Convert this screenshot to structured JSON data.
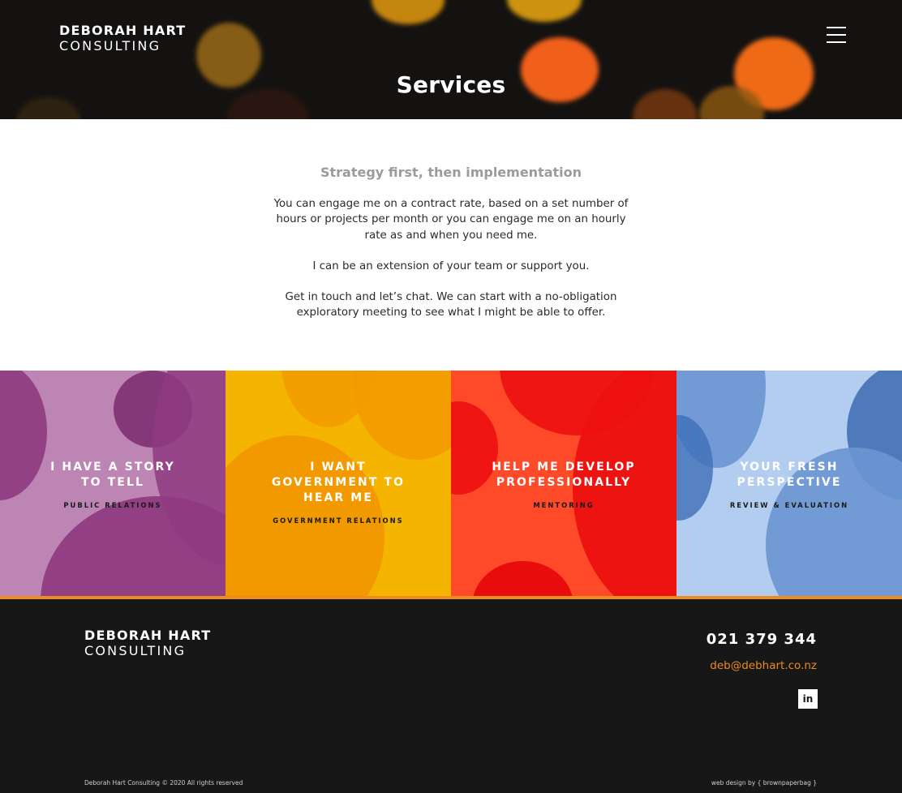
{
  "header": {
    "logo_line1": "DEBORAH HART",
    "logo_line2": "CONSULTING",
    "menu_icon": "hamburger-icon",
    "title": "Services"
  },
  "intro": {
    "heading": "Strategy first, then implementation",
    "paragraph1": "You can engage me on a contract rate, based on a set number of hours or projects per month or you can engage me on an hourly rate as and when you need me.",
    "paragraph2": "I can be an extension of your team or support you.",
    "paragraph3": "Get in touch and let’s chat. We can start with a no-obligation exploratory meeting to see what I might be able to offer."
  },
  "tiles": [
    {
      "title": "I HAVE A STORY TO TELL",
      "subtitle": "PUBLIC RELATIONS",
      "color": "#8e3a80"
    },
    {
      "title": "I WANT GOVERNMENT TO HEAR ME",
      "subtitle": "GOVERNMENT RELATIONS",
      "color": "#f5a300"
    },
    {
      "title": "HELP ME DEVELOP PROFESSIONALLY",
      "subtitle": "MENTORING",
      "color": "#ee2a10"
    },
    {
      "title": "YOUR FRESH PERSPECTIVE",
      "subtitle": "REVIEW & EVALUATION",
      "color": "#6a96d1"
    }
  ],
  "footer": {
    "logo_line1": "DEBORAH HART",
    "logo_line2": "CONSULTING",
    "phone": "021 379 344",
    "email": "deb@debhart.co.nz",
    "social_icon": "linkedin-icon",
    "social_label": "in",
    "copyright": "Deborah Hart Consulting © 2020 All rights reserved",
    "credit": "web design by { brownpaperbag }",
    "accent_color": "#ef8a1e"
  }
}
